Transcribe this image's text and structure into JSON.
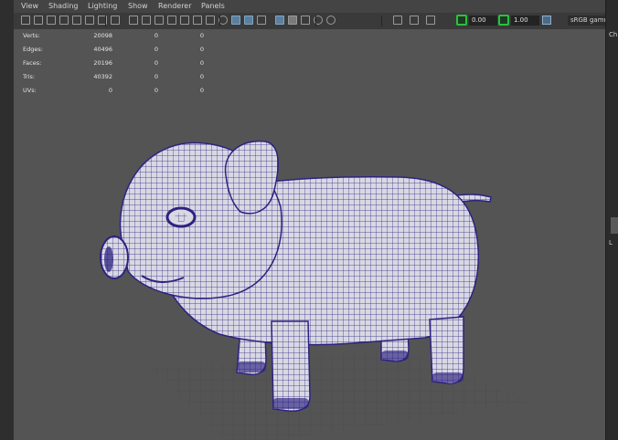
{
  "menu": [
    "View",
    "Shading",
    "Lighting",
    "Show",
    "Renderer",
    "Panels"
  ],
  "toolbar": {
    "icons": [
      "select-camera-icon",
      "camera-attributes-icon",
      "bookmark-icon",
      "image-plane-icon",
      "2d-pan-zoom-icon",
      "grease-pencil-icon",
      "grid-icon",
      "film-gate-icon",
      "resolution-gate-icon",
      "gate-mask-icon",
      "field-chart-icon",
      "safe-action-icon",
      "safe-title-icon",
      "wireframe-icon",
      "smooth-shade-icon",
      "wireframe-on-shaded-icon",
      "textured-icon",
      "use-all-lights-icon",
      "shadows-icon",
      "screen-space-ao-icon",
      "motion-blur-icon",
      "multisample-aa-icon",
      "depth-of-field-icon",
      "isolate-select-icon",
      "xray-icon",
      "xray-joints-icon",
      "backface-culling-icon"
    ],
    "exposure_value": "0.00",
    "gamma_value": "1.00",
    "colorspace_label": "sRGB gamm"
  },
  "hud": {
    "rows": [
      {
        "label": "Verts:",
        "v1": "20098",
        "v2": "0",
        "v3": "0"
      },
      {
        "label": "Edges:",
        "v1": "40496",
        "v2": "0",
        "v3": "0"
      },
      {
        "label": "Faces:",
        "v1": "20196",
        "v2": "0",
        "v3": "0"
      },
      {
        "label": "Tris:",
        "v1": "40392",
        "v2": "0",
        "v3": "0"
      },
      {
        "label": "UVs:",
        "v1": "0",
        "v2": "0",
        "v3": "0"
      }
    ]
  },
  "right_panel": {
    "text_top": "Ch",
    "text_mid": "L"
  },
  "colors": {
    "viewport_bg": "#545454",
    "wire": "#2c2280",
    "fill": "#d8d8e3",
    "grid": "#4a4a4a",
    "accent_green": "#29c23f"
  }
}
